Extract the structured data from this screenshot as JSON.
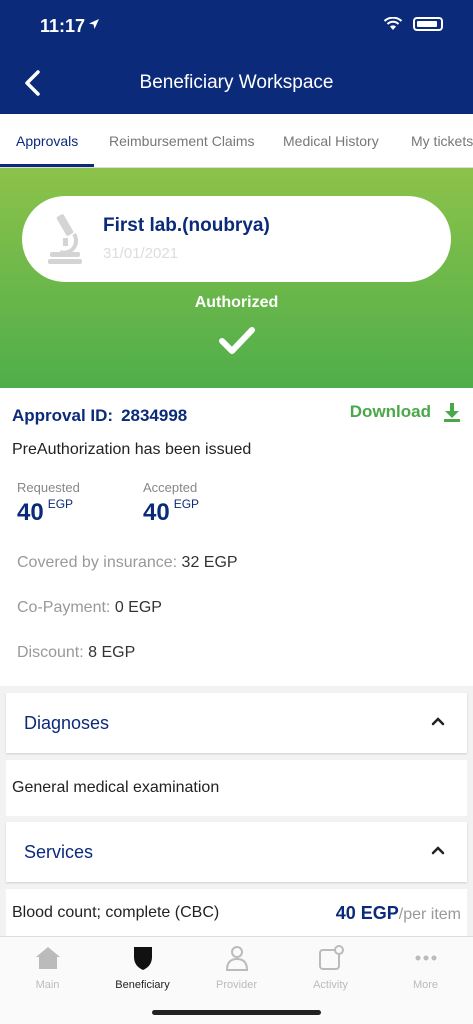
{
  "status_bar": {
    "time": "11:17"
  },
  "header": {
    "title": "Beneficiary Workspace"
  },
  "tabs": [
    {
      "label": "Approvals"
    },
    {
      "label": "Reimbursement Claims"
    },
    {
      "label": "Medical History"
    },
    {
      "label": "My tickets"
    }
  ],
  "provider": {
    "name": "First lab.(noubrya)",
    "date": "31/01/2021"
  },
  "approval_status": "Authorized",
  "approval": {
    "id_label": "Approval ID:",
    "id_value": "2834998",
    "download_label": "Download",
    "message": "PreAuthorization has been issued",
    "requested_label": "Requested",
    "requested_value": "40",
    "accepted_label": "Accepted",
    "accepted_value": "40",
    "currency": "EGP",
    "covered_label": "Covered by insurance:",
    "covered_value": "32 EGP",
    "copay_label": "Co-Payment:",
    "copay_value": "0 EGP",
    "discount_label": "Discount:",
    "discount_value": "8 EGP"
  },
  "diagnoses": {
    "title": "Diagnoses",
    "items": [
      "General medical examination"
    ]
  },
  "services": {
    "title": "Services",
    "items": [
      {
        "name": "Blood count; complete (CBC)",
        "price": "40 EGP",
        "unit": "/per item"
      }
    ]
  },
  "bottom_nav": [
    {
      "label": "Main",
      "icon": "home-icon"
    },
    {
      "label": "Beneficiary",
      "icon": "shield-icon"
    },
    {
      "label": "Provider",
      "icon": "doctor-icon"
    },
    {
      "label": "Activity",
      "icon": "activity-icon"
    },
    {
      "label": "More",
      "icon": "more-icon"
    }
  ],
  "colors": {
    "primary": "#0b2a7a",
    "success": "#4aa84a"
  }
}
